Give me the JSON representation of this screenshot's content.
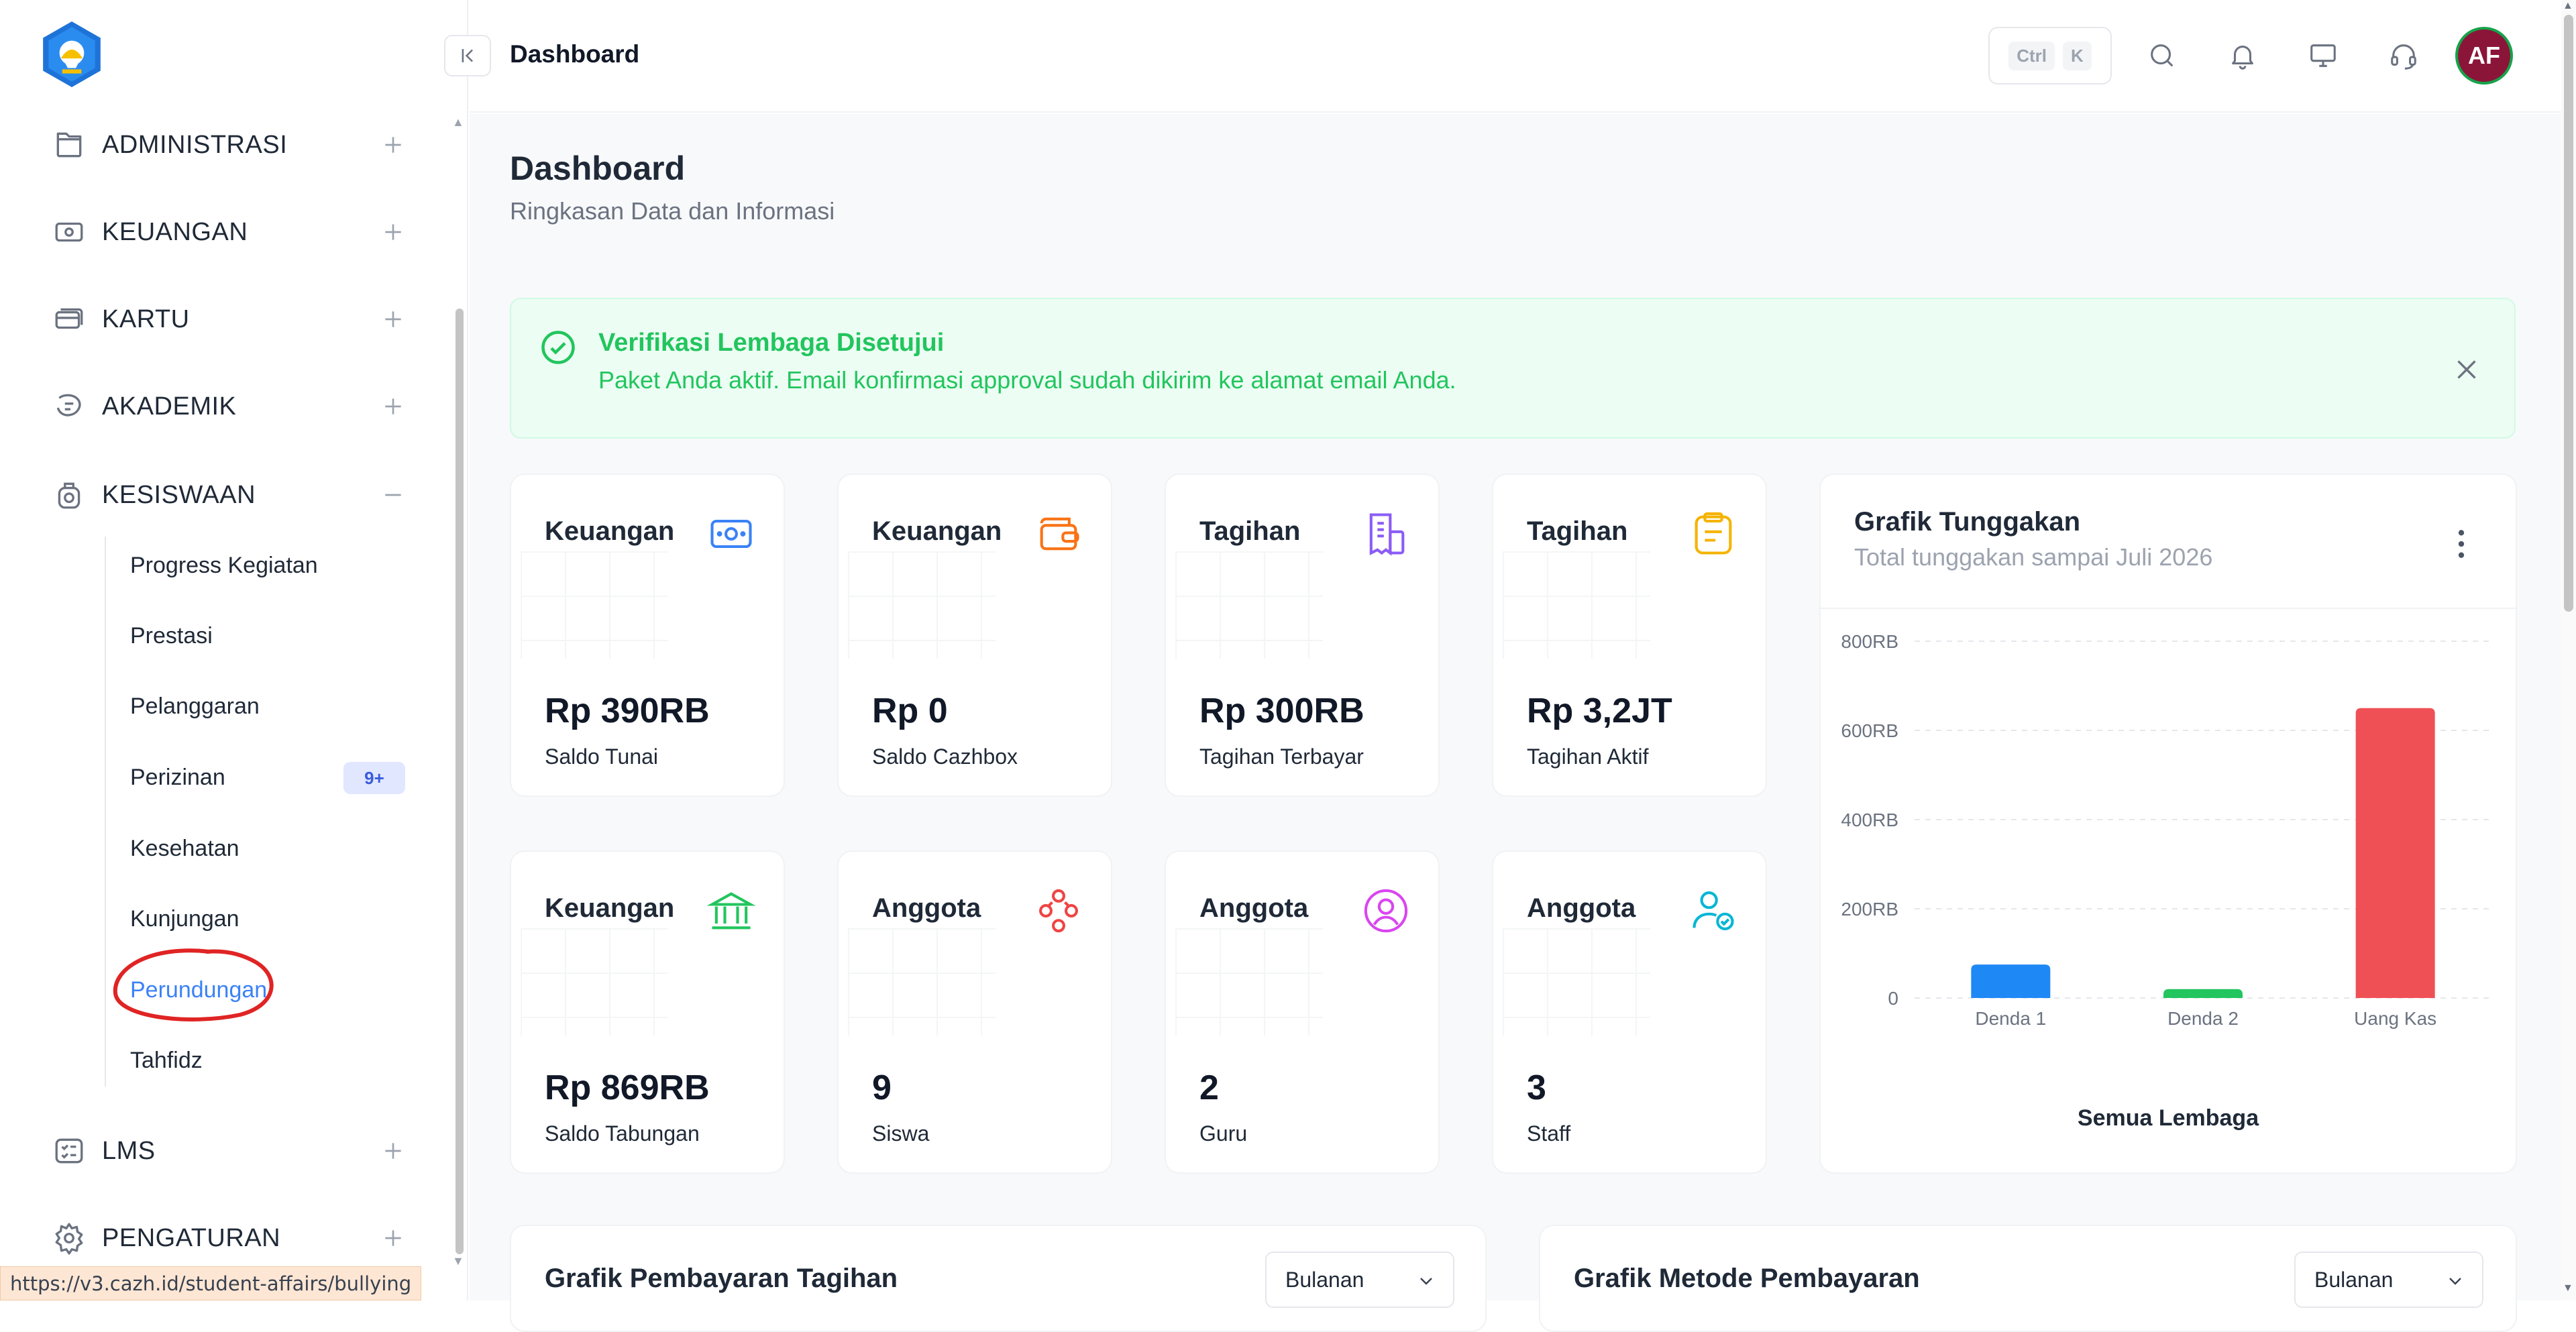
{
  "browser": {
    "status_url": "https://v3.cazh.id/student-affairs/bullying"
  },
  "sidebar": {
    "logo": "tut-wuri-handayani-logo",
    "items": [
      {
        "label": "ADMINISTRASI",
        "icon": "folder-icon",
        "toggle": "+"
      },
      {
        "label": "KEUANGAN",
        "icon": "money-icon",
        "toggle": "+"
      },
      {
        "label": "KARTU",
        "icon": "card-icon",
        "toggle": "+"
      },
      {
        "label": "AKADEMIK",
        "icon": "academic-icon",
        "toggle": "+"
      },
      {
        "label": "KESISWAAN",
        "icon": "student-icon",
        "toggle": "−"
      },
      {
        "label": "LMS",
        "icon": "checklist-icon",
        "toggle": "+"
      },
      {
        "label": "PENGATURAN",
        "icon": "gear-icon",
        "toggle": "+"
      }
    ],
    "kesiswaan_sub": [
      {
        "label": "Progress Kegiatan"
      },
      {
        "label": "Prestasi"
      },
      {
        "label": "Pelanggaran"
      },
      {
        "label": "Perizinan",
        "badge": "9+"
      },
      {
        "label": "Kesehatan"
      },
      {
        "label": "Kunjungan"
      },
      {
        "label": "Perundungan",
        "active": true
      },
      {
        "label": "Tahfidz"
      }
    ]
  },
  "header": {
    "breadcrumb": "Dashboard",
    "shortcut": {
      "key1": "Ctrl",
      "key2": "K"
    },
    "icons": [
      "search-icon",
      "bell-icon",
      "monitor-icon",
      "headset-icon"
    ],
    "avatar_initials": "AF"
  },
  "page": {
    "title": "Dashboard",
    "subtitle": "Ringkasan Data dan Informasi"
  },
  "alert": {
    "title": "Verifikasi Lembaga Disetujui",
    "message": "Paket Anda aktif. Email konfirmasi approval sudah dikirim ke alamat email Anda."
  },
  "cards": [
    {
      "title": "Keuangan",
      "value": "Rp 390RB",
      "label": "Saldo Tunai",
      "icon": "cash-icon",
      "color": "#3b82f6"
    },
    {
      "title": "Keuangan",
      "value": "Rp 0",
      "label": "Saldo Cazhbox",
      "icon": "wallet-icon",
      "color": "#f97316"
    },
    {
      "title": "Tagihan",
      "value": "Rp 300RB",
      "label": "Tagihan Terbayar",
      "icon": "invoice-icon",
      "color": "#8b5cf6"
    },
    {
      "title": "Tagihan",
      "value": "Rp 3,2JT",
      "label": "Tagihan Aktif",
      "icon": "clipboard-icon",
      "color": "#f5b301"
    },
    {
      "title": "Keuangan",
      "value": "Rp 869RB",
      "label": "Saldo Tabungan",
      "icon": "bank-icon",
      "color": "#22c55e"
    },
    {
      "title": "Anggota",
      "value": "9",
      "label": "Siswa",
      "icon": "group-icon",
      "color": "#ef4444"
    },
    {
      "title": "Anggota",
      "value": "2",
      "label": "Guru",
      "icon": "user-circle-icon",
      "color": "#d946ef"
    },
    {
      "title": "Anggota",
      "value": "3",
      "label": "Staff",
      "icon": "user-check-icon",
      "color": "#06b6d4"
    }
  ],
  "chart_panel": {
    "title": "Grafik Tunggakan",
    "subtitle": "Total tunggakan sampai Juli 2026",
    "legend": "Semua Lembaga"
  },
  "chart_data": {
    "type": "bar",
    "categories": [
      "Denda 1",
      "Denda 2",
      "Uang Kas"
    ],
    "values": [
      75000,
      20000,
      650000
    ],
    "colors": [
      "#1e88f5",
      "#22c55e",
      "#ef5055"
    ],
    "ylim": [
      0,
      800000
    ],
    "yticks": [
      {
        "value": 0,
        "label": "0"
      },
      {
        "value": 200000,
        "label": "200RB"
      },
      {
        "value": 400000,
        "label": "400RB"
      },
      {
        "value": 600000,
        "label": "600RB"
      },
      {
        "value": 800000,
        "label": "800RB"
      }
    ],
    "grid": true,
    "title": "Grafik Tunggakan",
    "xlabel": "Semua Lembaga",
    "ylabel": ""
  },
  "bottom_cards": [
    {
      "title": "Grafik Pembayaran Tagihan",
      "select_value": "Bulanan"
    },
    {
      "title": "Grafik Metode Pembayaran",
      "select_value": "Bulanan"
    }
  ]
}
